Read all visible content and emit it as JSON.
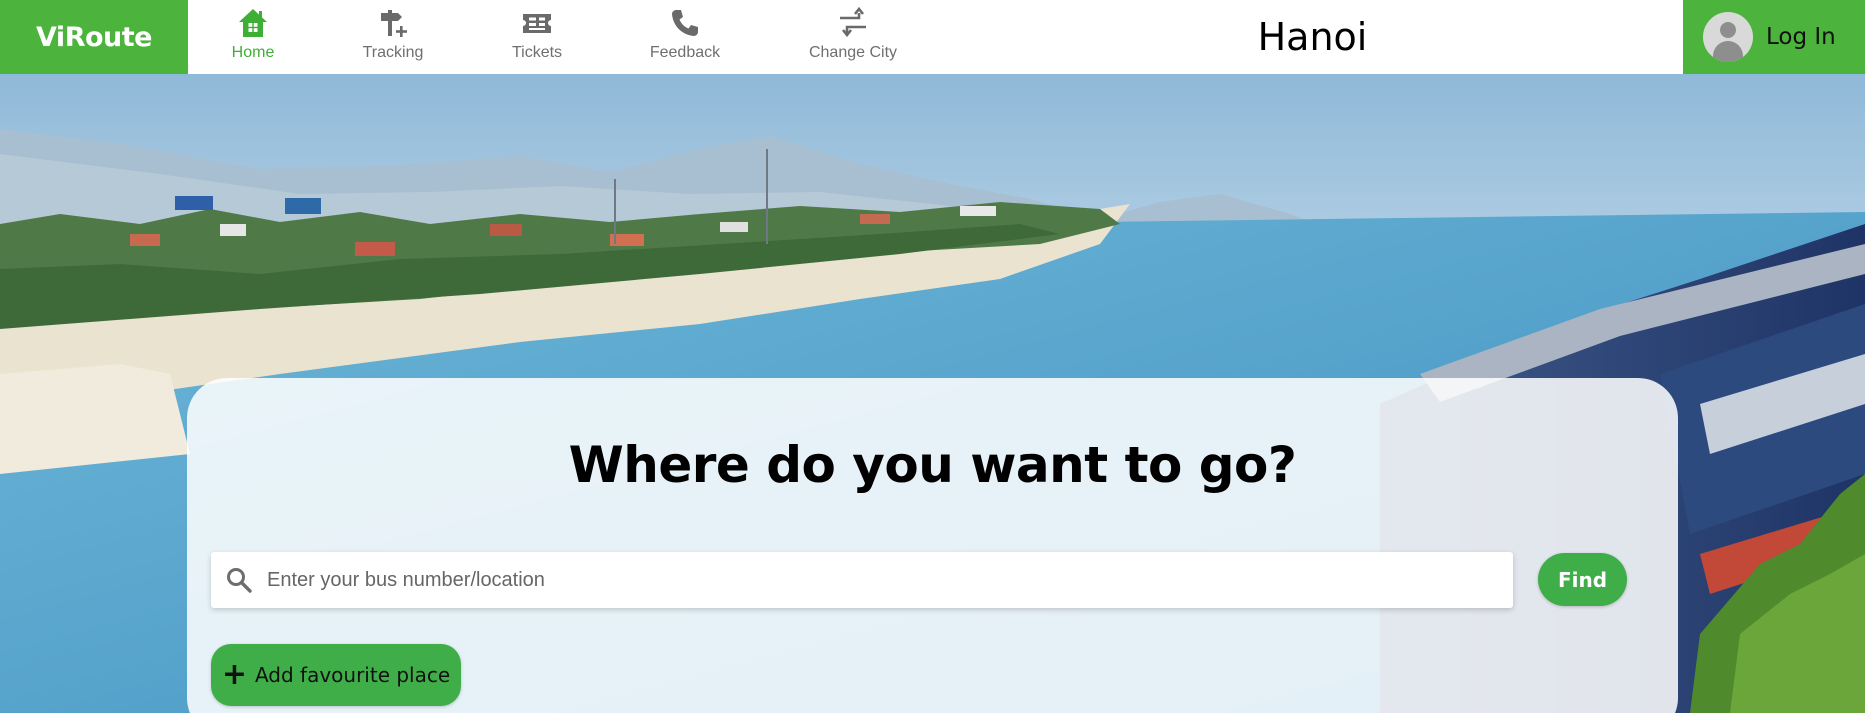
{
  "brand": {
    "name": "ViRoute"
  },
  "nav": {
    "items": [
      {
        "label": "Home",
        "icon": "home-icon",
        "active": true
      },
      {
        "label": "Tracking",
        "icon": "signpost-icon",
        "active": false
      },
      {
        "label": "Tickets",
        "icon": "ticket-icon",
        "active": false
      },
      {
        "label": "Feedback",
        "icon": "phone-icon",
        "active": false
      },
      {
        "label": "Change City",
        "icon": "swap-arrows-icon",
        "active": false
      }
    ]
  },
  "header": {
    "city": "Hanoi"
  },
  "account": {
    "login_label": "Log In",
    "avatar_icon": "user-avatar-icon"
  },
  "search": {
    "headline": "Where do you want to go?",
    "placeholder": "Enter your bus number/location",
    "value": "",
    "find_label": "Find",
    "icon": "search-icon"
  },
  "favourites": {
    "add_label": "Add favourite place",
    "icon": "plus-icon"
  },
  "colors": {
    "accent": "#4cb43c",
    "button": "#3fae48",
    "nav_active": "#3fae35",
    "nav_inactive": "#6f6f6f"
  }
}
